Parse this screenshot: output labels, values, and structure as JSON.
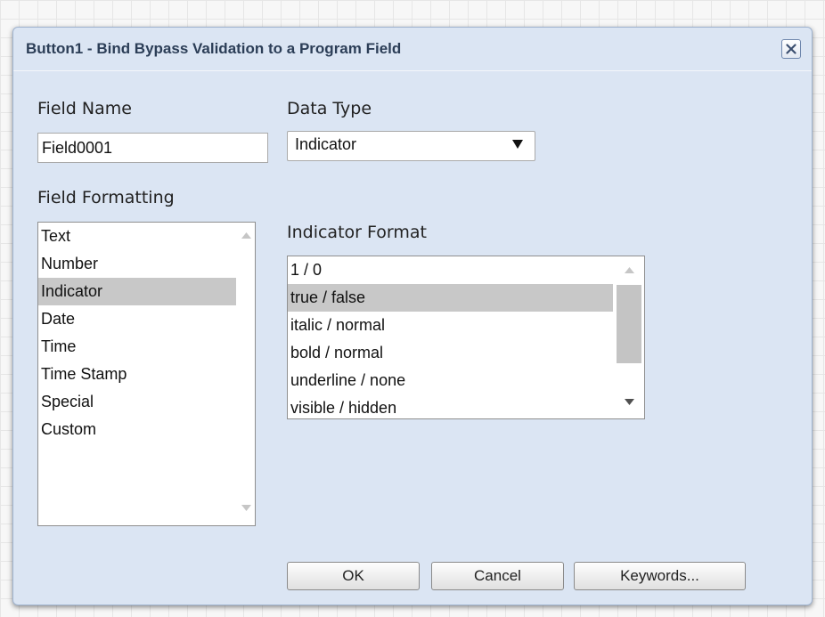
{
  "dialog": {
    "title": "Button1 - Bind Bypass Validation to a Program Field"
  },
  "field_name": {
    "label": "Field Name",
    "value": "Field0001"
  },
  "data_type": {
    "label": "Data Type",
    "selected": "Indicator"
  },
  "field_formatting": {
    "label": "Field Formatting",
    "items": [
      "Text",
      "Number",
      "Indicator",
      "Date",
      "Time",
      "Time Stamp",
      "Special",
      "Custom"
    ],
    "selected_index": 2
  },
  "indicator_format": {
    "label": "Indicator Format",
    "items": [
      "1 / 0",
      "true / false",
      "italic / normal",
      "bold / normal",
      "underline / none",
      "visible / hidden"
    ],
    "selected_index": 1
  },
  "buttons": {
    "ok": "OK",
    "cancel": "Cancel",
    "keywords": "Keywords..."
  },
  "icons": {
    "close": "close-icon",
    "dropdown": "triangle-down-icon",
    "scroll_up": "scroll-up-arrow-icon",
    "scroll_down": "scroll-down-arrow-icon"
  },
  "colors": {
    "dialog_background": "#dbe5f3",
    "title_text": "#2c3e57",
    "selection": "#c8c8c8"
  }
}
